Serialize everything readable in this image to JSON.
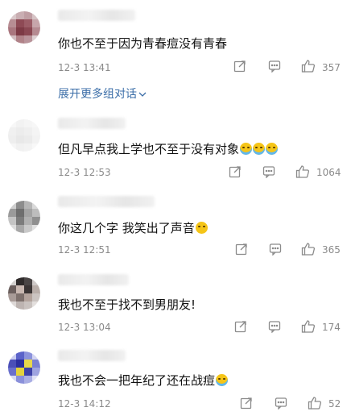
{
  "comments": [
    {
      "text": "你也不至于因为青春痘没有青春",
      "emoji": "",
      "time": "12-3 13:41",
      "likes": "357"
    },
    {
      "text": "但凡早点我上学也不至于没有对象",
      "emoji": "loudly-crying-face x3",
      "time": "12-3 12:53",
      "likes": "1064"
    },
    {
      "text": "你这几个字 我笑出了声音",
      "emoji": "laughing-face",
      "time": "12-3 12:51",
      "likes": "365"
    },
    {
      "text": "我也不至于找不到男朋友!",
      "emoji": "",
      "time": "12-3 13:04",
      "likes": "174"
    },
    {
      "text": "我也不会一把年纪了还在战痘",
      "emoji": "crying-face",
      "time": "12-3 14:12",
      "likes": "52"
    }
  ],
  "expand_link": "展开更多组对话",
  "icons": {
    "share": "share-icon",
    "reply": "reply-icon",
    "like": "thumbs-up-icon",
    "chevron": "chevron-down-icon"
  },
  "colors": {
    "link": "#3b6ea8",
    "meta": "#8a8a8a",
    "text": "#111111"
  }
}
